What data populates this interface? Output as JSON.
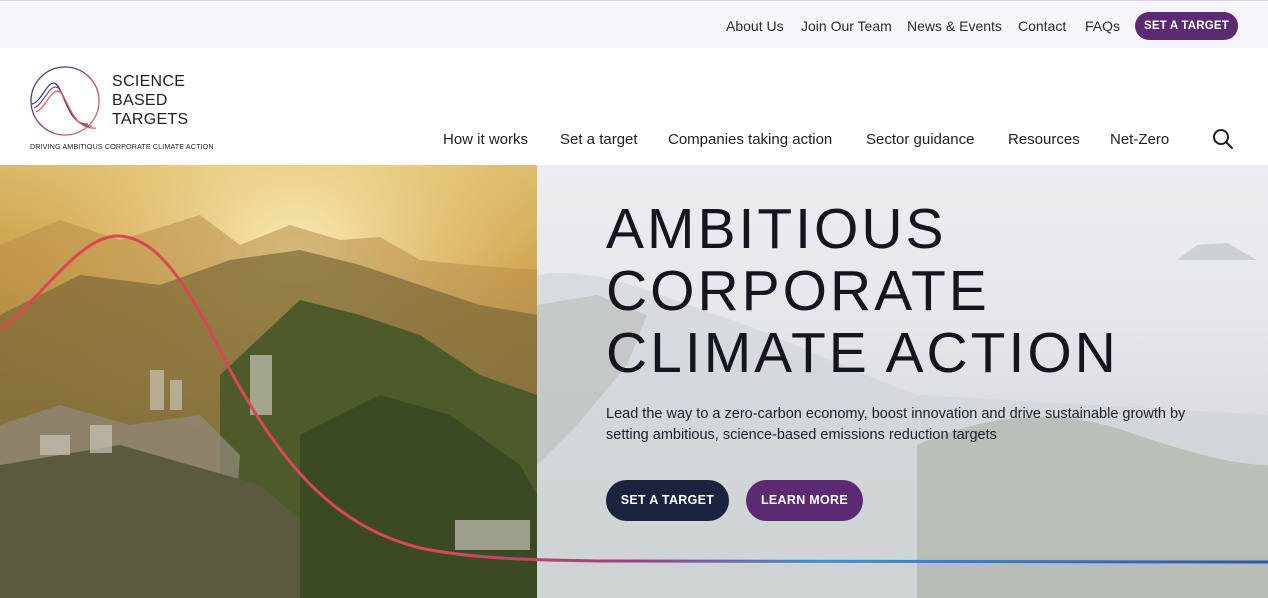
{
  "utility_nav": {
    "links": [
      "About Us",
      "Join Our Team",
      "News & Events",
      "Contact",
      "FAQs"
    ],
    "cta_label": "SET A TARGET"
  },
  "logo": {
    "line1": "SCIENCE",
    "line2": "BASED",
    "line3": "TARGETS",
    "tagline": "DRIVING AMBITIOUS CORPORATE CLIMATE ACTION"
  },
  "main_nav": {
    "items": [
      "How it works",
      "Set a target",
      "Companies taking action",
      "Sector guidance",
      "Resources",
      "Net-Zero"
    ],
    "search_icon": "search-icon"
  },
  "hero": {
    "title_line1": "AMBITIOUS",
    "title_line2": "CORPORATE",
    "title_line3": "CLIMATE ACTION",
    "subtitle": "Lead the way to a zero-carbon economy, boost innovation and drive sustainable growth by setting ambitious, science-based emissions reduction targets",
    "primary_button": "SET A TARGET",
    "secondary_button": "LEARN MORE"
  },
  "colors": {
    "accent_purple": "#5b2a73",
    "navy": "#1c2340",
    "curve_red": "#e0454f",
    "curve_blue": "#2f56b0"
  }
}
